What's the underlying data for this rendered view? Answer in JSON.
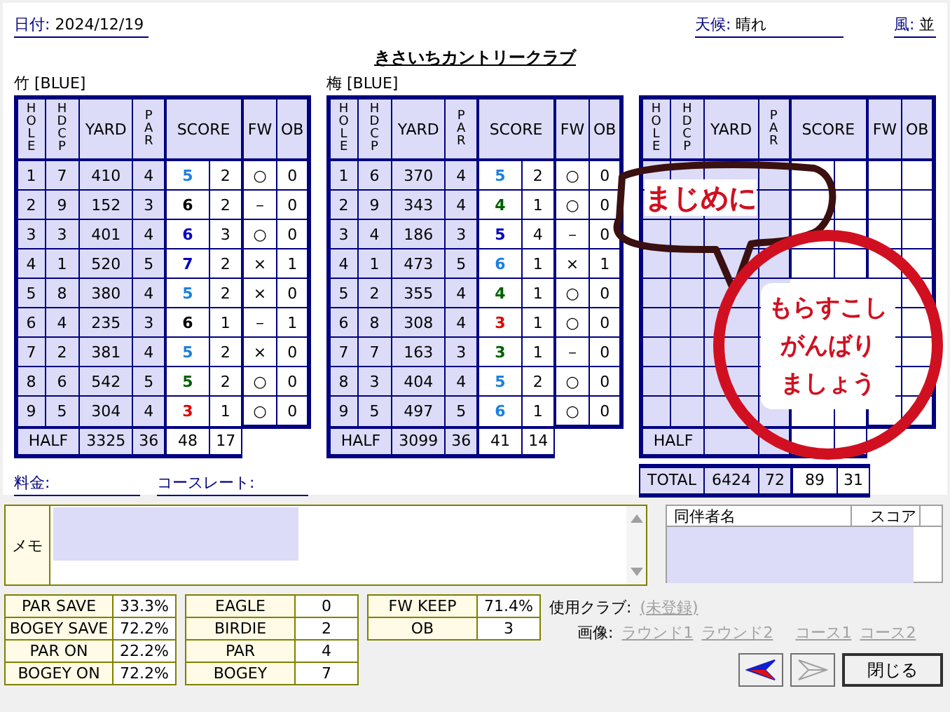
{
  "date": {
    "label": "日付:",
    "value": "2024/12/19"
  },
  "weather": {
    "label": "天候:",
    "value": "晴れ"
  },
  "wind": {
    "label": "風:",
    "value": "並"
  },
  "title": "きさいちカントリークラブ",
  "courses": [
    {
      "name": "竹 [BLUE]",
      "columns": [
        {
          "label": "HOLE",
          "vertical": true
        },
        {
          "label": "HDCP",
          "vertical": true
        },
        {
          "label": "YARD",
          "vertical": false
        },
        {
          "label": "PAR",
          "vertical": true
        },
        {
          "label": "SCORE",
          "vertical": false
        },
        {
          "label": "FW",
          "vertical": false
        },
        {
          "label": "OB",
          "vertical": false
        }
      ],
      "holes": [
        {
          "hole": "1",
          "hdcp": "7",
          "yard": "410",
          "par": "4",
          "score": "5",
          "color": "#1a80e0",
          "putts": "2",
          "fw": "○",
          "ob": "0"
        },
        {
          "hole": "2",
          "hdcp": "9",
          "yard": "152",
          "par": "3",
          "score": "6",
          "color": "#000000",
          "putts": "2",
          "fw": "－",
          "ob": "0"
        },
        {
          "hole": "3",
          "hdcp": "3",
          "yard": "401",
          "par": "4",
          "score": "6",
          "color": "#0000c0",
          "putts": "3",
          "fw": "○",
          "ob": "0"
        },
        {
          "hole": "4",
          "hdcp": "1",
          "yard": "520",
          "par": "5",
          "score": "7",
          "color": "#0000c0",
          "putts": "2",
          "fw": "×",
          "ob": "1"
        },
        {
          "hole": "5",
          "hdcp": "8",
          "yard": "380",
          "par": "4",
          "score": "5",
          "color": "#1a80e0",
          "putts": "2",
          "fw": "×",
          "ob": "0"
        },
        {
          "hole": "6",
          "hdcp": "4",
          "yard": "235",
          "par": "3",
          "score": "6",
          "color": "#000000",
          "putts": "1",
          "fw": "－",
          "ob": "1"
        },
        {
          "hole": "7",
          "hdcp": "2",
          "yard": "381",
          "par": "4",
          "score": "5",
          "color": "#1a80e0",
          "putts": "2",
          "fw": "×",
          "ob": "0"
        },
        {
          "hole": "8",
          "hdcp": "6",
          "yard": "542",
          "par": "5",
          "score": "5",
          "color": "#006000",
          "putts": "2",
          "fw": "○",
          "ob": "0"
        },
        {
          "hole": "9",
          "hdcp": "5",
          "yard": "304",
          "par": "4",
          "score": "3",
          "color": "#e00000",
          "putts": "1",
          "fw": "○",
          "ob": "0"
        }
      ],
      "half": {
        "label": "HALF",
        "yard": "3325",
        "par": "36",
        "score": "48",
        "putts": "17"
      }
    },
    {
      "name": "梅 [BLUE]",
      "columns": [
        {
          "label": "HOLE",
          "vertical": true
        },
        {
          "label": "HDCP",
          "vertical": true
        },
        {
          "label": "YARD",
          "vertical": false
        },
        {
          "label": "PAR",
          "vertical": true
        },
        {
          "label": "SCORE",
          "vertical": false
        },
        {
          "label": "FW",
          "vertical": false
        },
        {
          "label": "OB",
          "vertical": false
        }
      ],
      "holes": [
        {
          "hole": "1",
          "hdcp": "6",
          "yard": "370",
          "par": "4",
          "score": "5",
          "color": "#1a80e0",
          "putts": "2",
          "fw": "○",
          "ob": "0"
        },
        {
          "hole": "2",
          "hdcp": "9",
          "yard": "343",
          "par": "4",
          "score": "4",
          "color": "#006000",
          "putts": "1",
          "fw": "○",
          "ob": "0"
        },
        {
          "hole": "3",
          "hdcp": "4",
          "yard": "186",
          "par": "3",
          "score": "5",
          "color": "#0000c0",
          "putts": "4",
          "fw": "－",
          "ob": "0"
        },
        {
          "hole": "4",
          "hdcp": "1",
          "yard": "473",
          "par": "5",
          "score": "6",
          "color": "#1a80e0",
          "putts": "1",
          "fw": "×",
          "ob": "1"
        },
        {
          "hole": "5",
          "hdcp": "2",
          "yard": "355",
          "par": "4",
          "score": "4",
          "color": "#006000",
          "putts": "1",
          "fw": "○",
          "ob": "0"
        },
        {
          "hole": "6",
          "hdcp": "8",
          "yard": "308",
          "par": "4",
          "score": "3",
          "color": "#e00000",
          "putts": "1",
          "fw": "○",
          "ob": "0"
        },
        {
          "hole": "7",
          "hdcp": "7",
          "yard": "163",
          "par": "3",
          "score": "3",
          "color": "#006000",
          "putts": "1",
          "fw": "－",
          "ob": "0"
        },
        {
          "hole": "8",
          "hdcp": "3",
          "yard": "404",
          "par": "4",
          "score": "5",
          "color": "#1a80e0",
          "putts": "2",
          "fw": "○",
          "ob": "0"
        },
        {
          "hole": "9",
          "hdcp": "5",
          "yard": "497",
          "par": "5",
          "score": "6",
          "color": "#1a80e0",
          "putts": "1",
          "fw": "○",
          "ob": "0"
        }
      ],
      "half": {
        "label": "HALF",
        "yard": "3099",
        "par": "36",
        "score": "41",
        "putts": "14"
      }
    },
    {
      "columns": [
        {
          "label": "HOLE",
          "vertical": true
        },
        {
          "label": "HDCP",
          "vertical": true
        },
        {
          "label": "YARD",
          "vertical": false
        },
        {
          "label": "PAR",
          "vertical": true
        },
        {
          "label": "SCORE",
          "vertical": false
        },
        {
          "label": "FW",
          "vertical": false
        },
        {
          "label": "OB",
          "vertical": false
        }
      ],
      "half": {
        "label": "HALF"
      }
    }
  ],
  "total": {
    "label": "TOTAL",
    "yard": "6424",
    "par": "72",
    "score": "89",
    "putts": "31"
  },
  "notes": {
    "bubble": "まじめに",
    "stamp": [
      "もらすこし",
      "がんばり",
      "ましょう"
    ]
  },
  "fee": {
    "label": "料金:"
  },
  "course_rate": {
    "label": "コースレート:"
  },
  "memo": {
    "label": "メモ"
  },
  "companions": {
    "columns": [
      "同伴者名",
      "スコア"
    ]
  },
  "stats": [
    [
      {
        "label": "PAR SAVE",
        "value": "33.3%"
      },
      {
        "label": "BOGEY SAVE",
        "value": "72.2%"
      },
      {
        "label": "PAR ON",
        "value": "22.2%"
      },
      {
        "label": "BOGEY ON",
        "value": "72.2%"
      }
    ],
    [
      {
        "label": "EAGLE",
        "value": "0"
      },
      {
        "label": "BIRDIE",
        "value": "2"
      },
      {
        "label": "PAR",
        "value": "4"
      },
      {
        "label": "BOGEY",
        "value": "7"
      }
    ],
    [
      {
        "label": "FW KEEP",
        "value": "71.4%"
      },
      {
        "label": "OB",
        "value": "3"
      }
    ]
  ],
  "club": {
    "label": "使用クラブ:",
    "value": "(未登録)"
  },
  "images": {
    "label": "画像:",
    "links": [
      "ラウンド1",
      "ラウンド2",
      "コース1",
      "コース2"
    ]
  },
  "buttons": [
    {
      "kind": "prev",
      "disabled": false
    },
    {
      "kind": "next",
      "disabled": true
    },
    {
      "kind": "close",
      "label": "閉じる",
      "disabled": false
    }
  ]
}
